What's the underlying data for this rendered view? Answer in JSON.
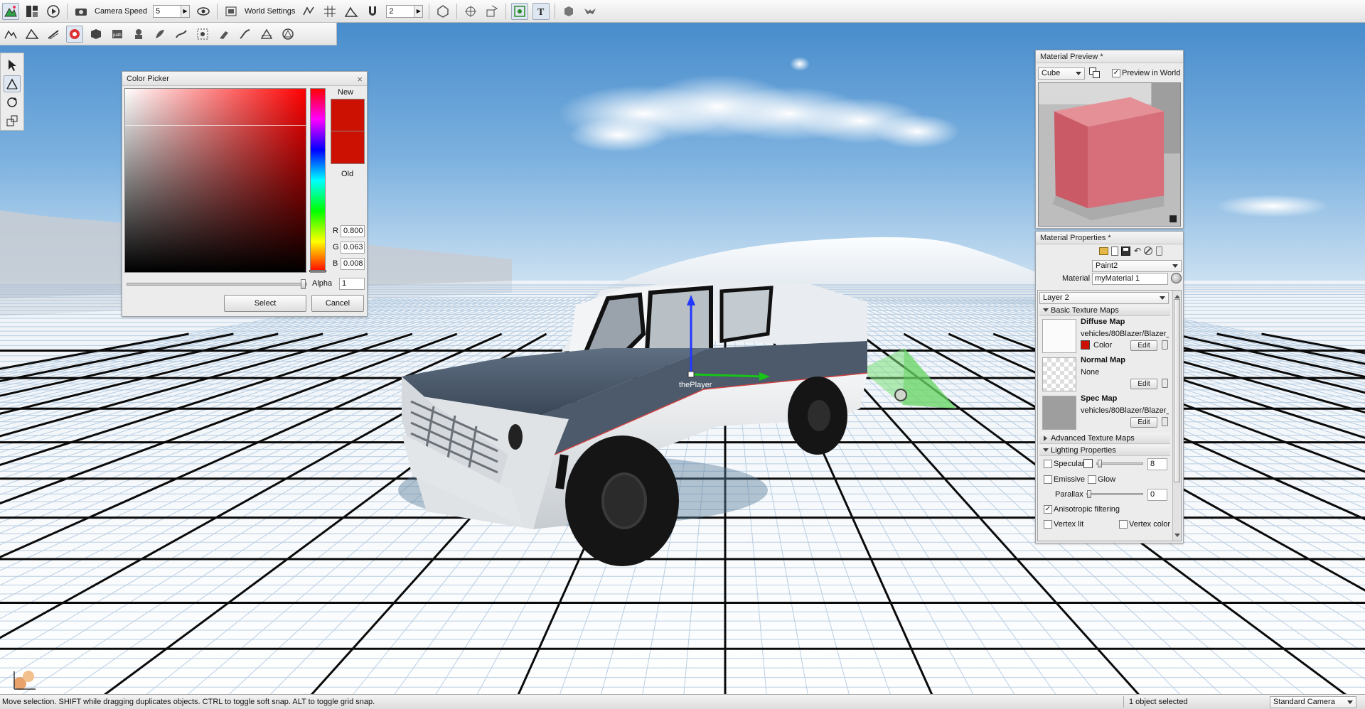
{
  "toolbar": {
    "camera_speed_label": "Camera Speed",
    "camera_speed_value": "5",
    "world_settings_label": "World Settings",
    "snap_value": "2"
  },
  "viewport": {
    "player_label": "thePlayer"
  },
  "color_picker": {
    "title": "Color Picker",
    "new_label": "New",
    "old_label": "Old",
    "r_label": "R",
    "r_value": "0.800",
    "g_label": "G",
    "g_value": "0.063",
    "b_label": "B",
    "b_value": "0.008",
    "alpha_label": "Alpha",
    "alpha_value": "1",
    "select_label": "Select",
    "cancel_label": "Cancel",
    "new_color": "#cc1002",
    "old_color": "#cc1002"
  },
  "material_preview": {
    "title": "Material Preview *",
    "shape_option": "Cube",
    "preview_in_world_label": "Preview in World",
    "preview_in_world_checked": true
  },
  "material_properties": {
    "title": "Material Properties *",
    "target_option": "Paint2",
    "material_label": "Material",
    "material_value": "myMaterial 1",
    "layer_option": "Layer 2",
    "basic_section": "Basic Texture Maps",
    "diffuse_title": "Diffuse Map",
    "diffuse_path": "vehicles/80Blazer/Blazer_",
    "color_label": "Color",
    "diffuse_color": "#cc1002",
    "edit_label": "Edit",
    "normal_title": "Normal Map",
    "normal_path": "None",
    "spec_title": "Spec Map",
    "spec_path": "vehicles/80Blazer/Blazer_",
    "advanced_section": "Advanced Texture Maps",
    "lighting_section": "Lighting Properties",
    "specular_label": "Specular",
    "specular_value": "8",
    "emissive_label": "Emissive",
    "glow_label": "Glow",
    "parallax_label": "Parallax",
    "parallax_value": "0",
    "anisotropic_label": "Anisotropic filtering",
    "anisotropic_checked": true,
    "vertex_lit_label": "Vertex lit",
    "vertex_color_label": "Vertex color"
  },
  "status_bar": {
    "message": "Move selection.  SHIFT while dragging duplicates objects.  CTRL to toggle soft snap.  ALT to toggle grid snap.",
    "selection_info": "1 object selected",
    "camera_mode": "Standard Camera"
  }
}
